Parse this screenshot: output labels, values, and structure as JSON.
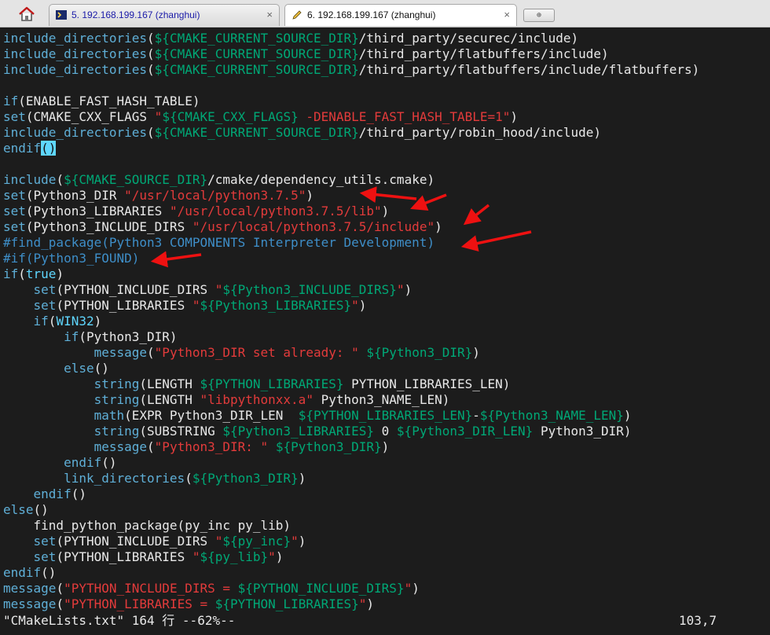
{
  "tabs": [
    {
      "label": "5. 192.168.199.167 (zhanghui)",
      "close": "×"
    },
    {
      "label": "6. 192.168.199.167 (zhanghui)",
      "close": "×"
    }
  ],
  "new_tab_symbol": "⊕",
  "lines": [
    [
      {
        "c": "fn",
        "t": "include_directories"
      },
      {
        "c": "",
        "t": "("
      },
      {
        "c": "var",
        "t": "${CMAKE_CURRENT_SOURCE_DIR}"
      },
      {
        "c": "",
        "t": "/third_party/securec/include)"
      }
    ],
    [
      {
        "c": "fn",
        "t": "include_directories"
      },
      {
        "c": "",
        "t": "("
      },
      {
        "c": "var",
        "t": "${CMAKE_CURRENT_SOURCE_DIR}"
      },
      {
        "c": "",
        "t": "/third_party/flatbuffers/include)"
      }
    ],
    [
      {
        "c": "fn",
        "t": "include_directories"
      },
      {
        "c": "",
        "t": "("
      },
      {
        "c": "var",
        "t": "${CMAKE_CURRENT_SOURCE_DIR}"
      },
      {
        "c": "",
        "t": "/third_party/flatbuffers/include/flatbuffers)"
      }
    ],
    [],
    [
      {
        "c": "fn",
        "t": "if"
      },
      {
        "c": "",
        "t": "(ENABLE_FAST_HASH_TABLE)"
      }
    ],
    [
      {
        "c": "fn",
        "t": "set"
      },
      {
        "c": "",
        "t": "(CMAKE_CXX_FLAGS "
      },
      {
        "c": "str",
        "t": "\""
      },
      {
        "c": "var",
        "t": "${CMAKE_CXX_FLAGS}"
      },
      {
        "c": "str",
        "t": " -DENABLE_FAST_HASH_TABLE=1\""
      },
      {
        "c": "",
        "t": ")"
      }
    ],
    [
      {
        "c": "fn",
        "t": "include_directories"
      },
      {
        "c": "",
        "t": "("
      },
      {
        "c": "var",
        "t": "${CMAKE_CURRENT_SOURCE_DIR}"
      },
      {
        "c": "",
        "t": "/third_party/robin_hood/include)"
      }
    ],
    [
      {
        "c": "fn",
        "t": "endif"
      },
      {
        "c": "cur",
        "t": "()"
      }
    ],
    [],
    [
      {
        "c": "fn",
        "t": "include"
      },
      {
        "c": "",
        "t": "("
      },
      {
        "c": "var",
        "t": "${CMAKE_SOURCE_DIR}"
      },
      {
        "c": "",
        "t": "/cmake/dependency_utils.cmake)"
      }
    ],
    [
      {
        "c": "fn",
        "t": "set"
      },
      {
        "c": "",
        "t": "(Python3_DIR "
      },
      {
        "c": "str",
        "t": "\"/usr/local/python3.7.5\""
      },
      {
        "c": "",
        "t": ")"
      }
    ],
    [
      {
        "c": "fn",
        "t": "set"
      },
      {
        "c": "",
        "t": "(Python3_LIBRARIES "
      },
      {
        "c": "str",
        "t": "\"/usr/local/python3.7.5/lib\""
      },
      {
        "c": "",
        "t": ")"
      }
    ],
    [
      {
        "c": "fn",
        "t": "set"
      },
      {
        "c": "",
        "t": "(Python3_INCLUDE_DIRS "
      },
      {
        "c": "str",
        "t": "\"/usr/local/python3.7.5/include\""
      },
      {
        "c": "",
        "t": ")"
      }
    ],
    [
      {
        "c": "cmt",
        "t": "#find_package(Python3 COMPONENTS Interpreter Development)"
      }
    ],
    [
      {
        "c": "cmt",
        "t": "#if(Python3_FOUND)"
      }
    ],
    [
      {
        "c": "fn",
        "t": "if"
      },
      {
        "c": "",
        "t": "("
      },
      {
        "c": "kw",
        "t": "true"
      },
      {
        "c": "",
        "t": ")"
      }
    ],
    [
      {
        "c": "",
        "t": "    "
      },
      {
        "c": "fn",
        "t": "set"
      },
      {
        "c": "",
        "t": "(PYTHON_INCLUDE_DIRS "
      },
      {
        "c": "str",
        "t": "\""
      },
      {
        "c": "var",
        "t": "${Python3_INCLUDE_DIRS}"
      },
      {
        "c": "str",
        "t": "\""
      },
      {
        "c": "",
        "t": ")"
      }
    ],
    [
      {
        "c": "",
        "t": "    "
      },
      {
        "c": "fn",
        "t": "set"
      },
      {
        "c": "",
        "t": "(PYTHON_LIBRARIES "
      },
      {
        "c": "str",
        "t": "\""
      },
      {
        "c": "var",
        "t": "${Python3_LIBRARIES}"
      },
      {
        "c": "str",
        "t": "\""
      },
      {
        "c": "",
        "t": ")"
      }
    ],
    [
      {
        "c": "",
        "t": "    "
      },
      {
        "c": "fn",
        "t": "if"
      },
      {
        "c": "",
        "t": "("
      },
      {
        "c": "kw",
        "t": "WIN32"
      },
      {
        "c": "",
        "t": ")"
      }
    ],
    [
      {
        "c": "",
        "t": "        "
      },
      {
        "c": "fn",
        "t": "if"
      },
      {
        "c": "",
        "t": "(Python3_DIR)"
      }
    ],
    [
      {
        "c": "",
        "t": "            "
      },
      {
        "c": "fn",
        "t": "message"
      },
      {
        "c": "",
        "t": "("
      },
      {
        "c": "str",
        "t": "\"Python3_DIR set already: \""
      },
      {
        "c": "",
        "t": " "
      },
      {
        "c": "var",
        "t": "${Python3_DIR}"
      },
      {
        "c": "",
        "t": ")"
      }
    ],
    [
      {
        "c": "",
        "t": "        "
      },
      {
        "c": "fn",
        "t": "else"
      },
      {
        "c": "",
        "t": "()"
      }
    ],
    [
      {
        "c": "",
        "t": "            "
      },
      {
        "c": "fn",
        "t": "string"
      },
      {
        "c": "",
        "t": "(LENGTH "
      },
      {
        "c": "var",
        "t": "${PYTHON_LIBRARIES}"
      },
      {
        "c": "",
        "t": " PYTHON_LIBRARIES_LEN)"
      }
    ],
    [
      {
        "c": "",
        "t": "            "
      },
      {
        "c": "fn",
        "t": "string"
      },
      {
        "c": "",
        "t": "(LENGTH "
      },
      {
        "c": "str",
        "t": "\"libpythonxx.a\""
      },
      {
        "c": "",
        "t": " Python3_NAME_LEN)"
      }
    ],
    [
      {
        "c": "",
        "t": "            "
      },
      {
        "c": "fn",
        "t": "math"
      },
      {
        "c": "",
        "t": "(EXPR Python3_DIR_LEN  "
      },
      {
        "c": "var",
        "t": "${PYTHON_LIBRARIES_LEN}"
      },
      {
        "c": "",
        "t": "-"
      },
      {
        "c": "var",
        "t": "${Python3_NAME_LEN}"
      },
      {
        "c": "",
        "t": ")"
      }
    ],
    [
      {
        "c": "",
        "t": "            "
      },
      {
        "c": "fn",
        "t": "string"
      },
      {
        "c": "",
        "t": "(SUBSTRING "
      },
      {
        "c": "var",
        "t": "${Python3_LIBRARIES}"
      },
      {
        "c": "",
        "t": " 0 "
      },
      {
        "c": "var",
        "t": "${Python3_DIR_LEN}"
      },
      {
        "c": "",
        "t": " Python3_DIR)"
      }
    ],
    [
      {
        "c": "",
        "t": "            "
      },
      {
        "c": "fn",
        "t": "message"
      },
      {
        "c": "",
        "t": "("
      },
      {
        "c": "str",
        "t": "\"Python3_DIR: \""
      },
      {
        "c": "",
        "t": " "
      },
      {
        "c": "var",
        "t": "${Python3_DIR}"
      },
      {
        "c": "",
        "t": ")"
      }
    ],
    [
      {
        "c": "",
        "t": "        "
      },
      {
        "c": "fn",
        "t": "endif"
      },
      {
        "c": "",
        "t": "()"
      }
    ],
    [
      {
        "c": "",
        "t": "        "
      },
      {
        "c": "fn",
        "t": "link_directories"
      },
      {
        "c": "",
        "t": "("
      },
      {
        "c": "var",
        "t": "${Python3_DIR}"
      },
      {
        "c": "",
        "t": ")"
      }
    ],
    [
      {
        "c": "",
        "t": "    "
      },
      {
        "c": "fn",
        "t": "endif"
      },
      {
        "c": "",
        "t": "()"
      }
    ],
    [
      {
        "c": "fn",
        "t": "else"
      },
      {
        "c": "",
        "t": "()"
      }
    ],
    [
      {
        "c": "",
        "t": "    find_python_package(py_inc py_lib)"
      }
    ],
    [
      {
        "c": "",
        "t": "    "
      },
      {
        "c": "fn",
        "t": "set"
      },
      {
        "c": "",
        "t": "(PYTHON_INCLUDE_DIRS "
      },
      {
        "c": "str",
        "t": "\""
      },
      {
        "c": "var",
        "t": "${py_inc}"
      },
      {
        "c": "str",
        "t": "\""
      },
      {
        "c": "",
        "t": ")"
      }
    ],
    [
      {
        "c": "",
        "t": "    "
      },
      {
        "c": "fn",
        "t": "set"
      },
      {
        "c": "",
        "t": "(PYTHON_LIBRARIES "
      },
      {
        "c": "str",
        "t": "\""
      },
      {
        "c": "var",
        "t": "${py_lib}"
      },
      {
        "c": "str",
        "t": "\""
      },
      {
        "c": "",
        "t": ")"
      }
    ],
    [
      {
        "c": "fn",
        "t": "endif"
      },
      {
        "c": "",
        "t": "()"
      }
    ],
    [
      {
        "c": "fn",
        "t": "message"
      },
      {
        "c": "",
        "t": "("
      },
      {
        "c": "str",
        "t": "\"PYTHON_INCLUDE_DIRS = "
      },
      {
        "c": "var",
        "t": "${PYTHON_INCLUDE_DIRS}"
      },
      {
        "c": "str",
        "t": "\""
      },
      {
        "c": "",
        "t": ")"
      }
    ],
    [
      {
        "c": "fn",
        "t": "message"
      },
      {
        "c": "",
        "t": "("
      },
      {
        "c": "str",
        "t": "\"PYTHON_LIBRARIES = "
      },
      {
        "c": "var",
        "t": "${PYTHON_LIBRARIES}"
      },
      {
        "c": "str",
        "t": "\""
      },
      {
        "c": "",
        "t": ")"
      }
    ]
  ],
  "status": {
    "left": "\"CMakeLists.txt\" 164 行 --62%--",
    "right": "103,7"
  },
  "colors": {
    "background": "#1c1c1c",
    "keyword": "#5fd7ff",
    "function": "#5fafd7",
    "variable": "#00a876",
    "string": "#e33b3b",
    "comment": "#3e8ec8",
    "annotation_arrow": "#ee1111"
  }
}
